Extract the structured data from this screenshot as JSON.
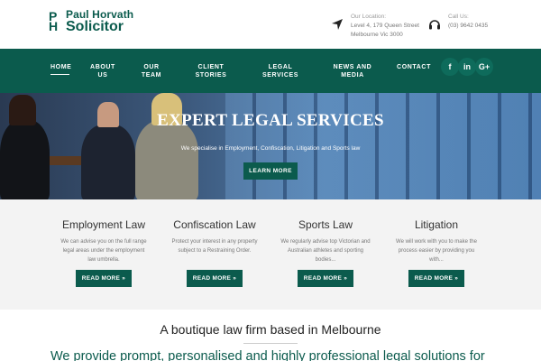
{
  "brand": {
    "logo_p": "P",
    "logo_h": "H",
    "name": "Paul Horvath",
    "title": "Solicitor"
  },
  "contact": {
    "location_label": "Our Location:",
    "location_line1": "Level 4, 179 Queen Street",
    "location_line2": "Melbourne Vic 3000",
    "phone_label": "Call Us:",
    "phone": "(03) 9642 0435"
  },
  "nav": {
    "items": [
      {
        "line1": "HOME",
        "line2": ""
      },
      {
        "line1": "ABOUT",
        "line2": "US"
      },
      {
        "line1": "OUR",
        "line2": "TEAM"
      },
      {
        "line1": "CLIENT",
        "line2": "STORIES"
      },
      {
        "line1": "LEGAL",
        "line2": "SERVICES"
      },
      {
        "line1": "NEWS AND",
        "line2": "MEDIA"
      },
      {
        "line1": "CONTACT",
        "line2": ""
      }
    ],
    "social": [
      "f",
      "in",
      "G+"
    ]
  },
  "hero": {
    "title": "EXPERT LEGAL SERVICES",
    "subtitle": "We specialise in Employment, Confiscation, Litigation and Sports law",
    "button": "LEARN MORE"
  },
  "services": [
    {
      "title": "Employment Law",
      "desc1": "We can advise you on the full range",
      "desc2": "legal areas under the employment",
      "desc3": "law umbrella.",
      "button": "READ MORE »"
    },
    {
      "title": "Confiscation Law",
      "desc1": "Protect your interest in any property",
      "desc2": "subject to a Restraining Order.",
      "desc3": "",
      "button": "READ MORE »"
    },
    {
      "title": "Sports Law",
      "desc1": "We regularly advise top Victorian and",
      "desc2": "Australian athletes and sporting",
      "desc3": "bodies...",
      "button": "READ MORE »"
    },
    {
      "title": "Litigation",
      "desc1": "We will work with you to make the",
      "desc2": "process easier by providing you",
      "desc3": "with...",
      "button": "READ MORE »"
    }
  ],
  "about": {
    "tagline": "A boutique law firm based in Melbourne",
    "statement": "We provide prompt, personalised and highly professional legal solutions for"
  },
  "colors": {
    "brand_green": "#0b5b4d"
  }
}
